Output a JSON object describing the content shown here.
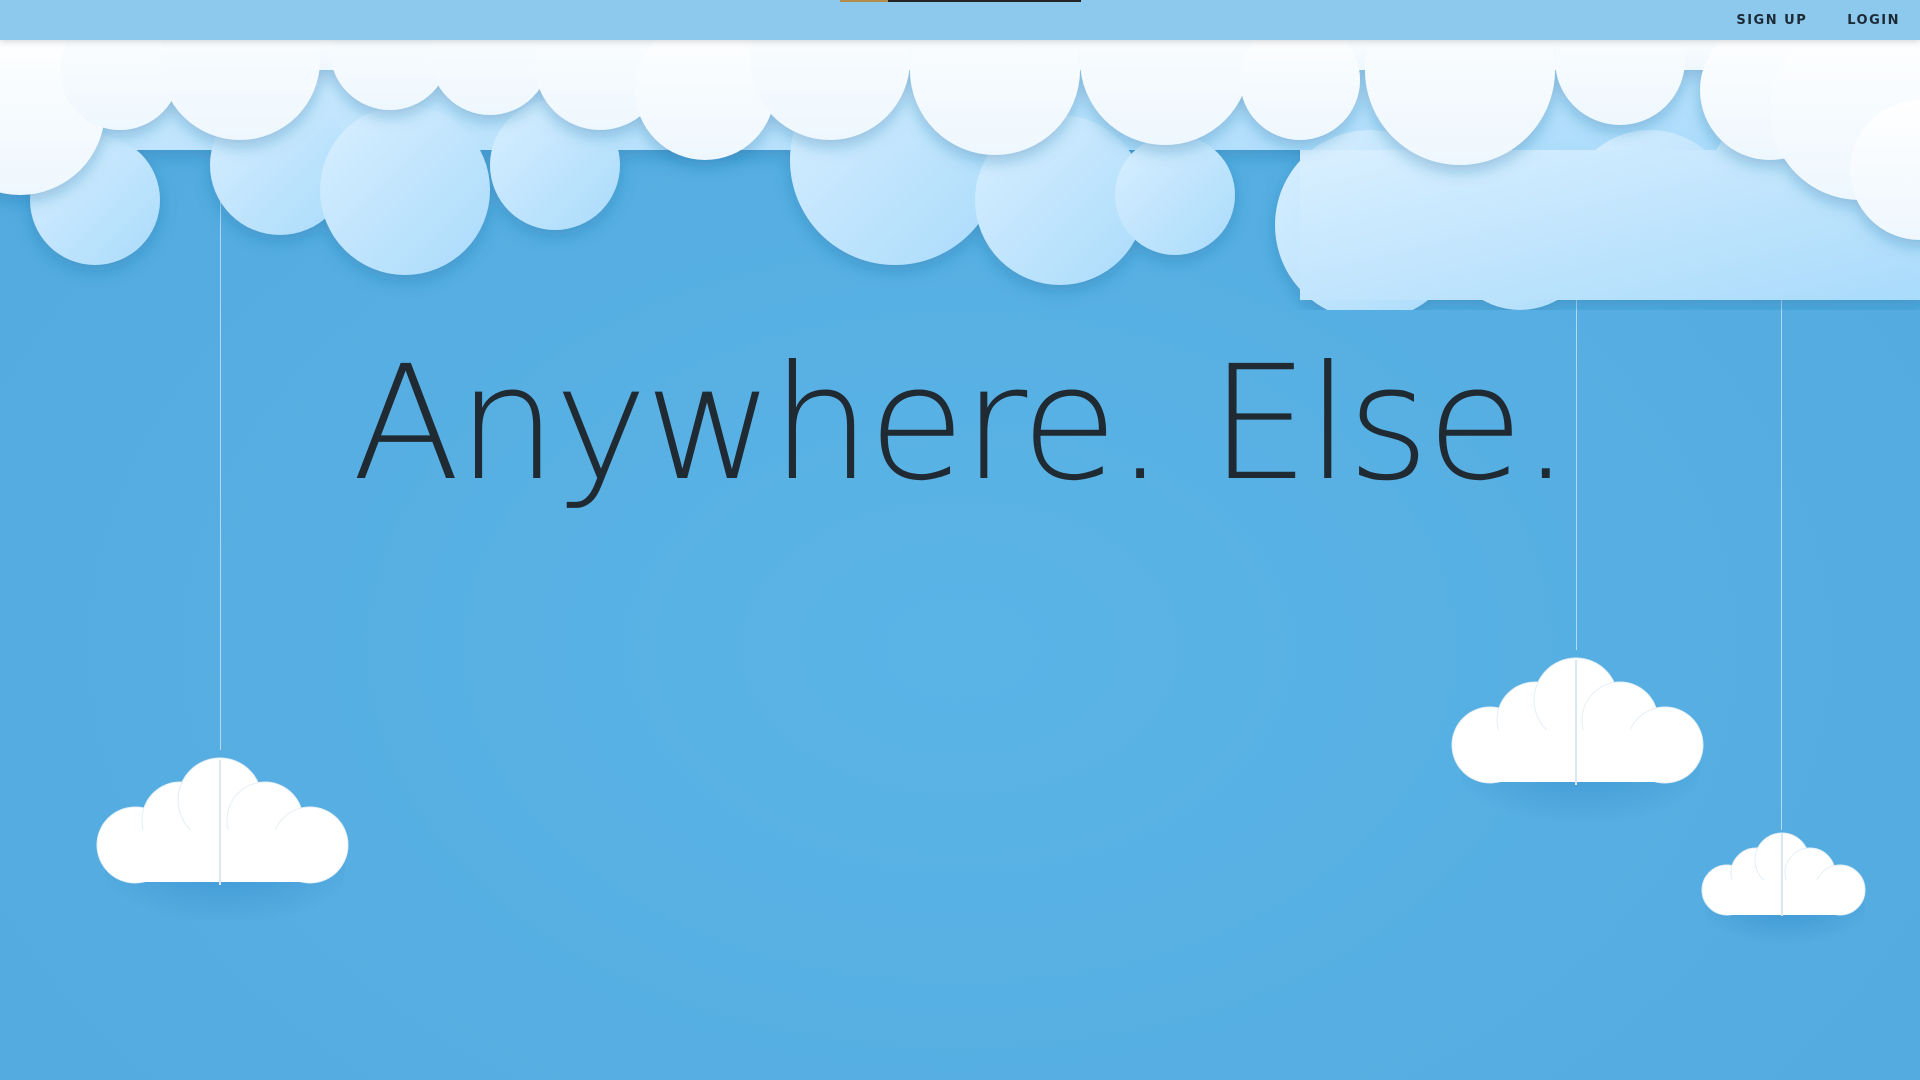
{
  "nav": {
    "signup_label": "SIGN UP",
    "login_label": "LOGIN"
  },
  "hero": {
    "headline": "Anywhere. Else."
  },
  "colors": {
    "sky": "#58b1e4",
    "topbar": "#8cc9ec",
    "text": "#1f2a33",
    "cloud_white": "#ffffff",
    "cloud_light": "#b3dff9"
  }
}
